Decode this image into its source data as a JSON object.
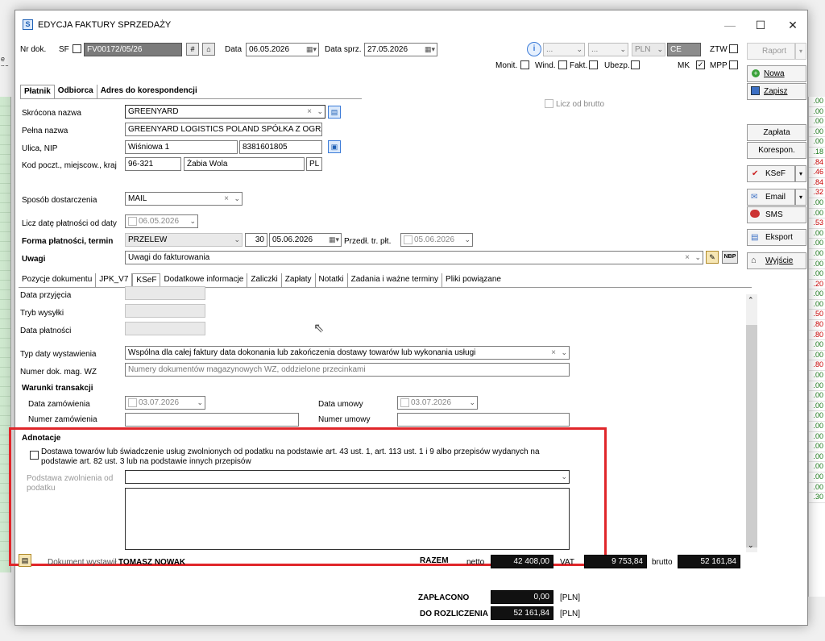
{
  "window": {
    "title": "EDYCJA FAKTURY SPRZEDAŻY"
  },
  "background": {
    "left_text": "e po",
    "right_values": [
      ".00",
      ".00",
      ".00",
      ".00",
      ".00",
      ".18",
      ".84",
      ".46",
      ".84",
      ".32",
      ".00",
      ".00",
      ".53",
      ".00",
      ".00",
      ".00",
      ".00",
      ".00",
      ".20",
      ".00",
      ".00",
      ".50",
      ".80",
      ".80",
      ".00",
      ".00",
      ".80",
      ".00",
      ".00",
      ".00",
      ".00",
      ".00",
      ".00",
      ".00",
      ".00",
      ".00",
      ".00",
      ".00",
      ".00",
      ".30"
    ]
  },
  "header": {
    "nr_dok_label": "Nr dok.",
    "sf_label": "SF",
    "nr_dok_value": "FV00172/05/26",
    "data_label": "Data",
    "data_value": "06.05.2026",
    "data_sprz_label": "Data sprz.",
    "data_sprz_value": "27.05.2026",
    "combo1": "...",
    "combo2": "...",
    "currency": "PLN",
    "ce_value": "CE",
    "ztw_label": "ZTW",
    "monit_label": "Monit.",
    "wind_label": "Wind.",
    "fakt_label": "Fakt.",
    "ubezp_label": "Ubezp.",
    "mk_label": "MK",
    "mpp_label": "MPP"
  },
  "party_tabs": [
    "Płatnik",
    "Odbiorca",
    "Adres do korespondencji"
  ],
  "liczbrutto_label": "Licz od brutto",
  "fields": {
    "skrocona_label": "Skrócona nazwa",
    "skrocona_value": "GREENYARD",
    "pelna_label": "Pełna nazwa",
    "pelna_value": "GREENYARD LOGISTICS POLAND SPÓŁKA Z OGRANICZO",
    "ulica_label": "Ulica, NIP",
    "ulica_value": "Wiśniowa 1",
    "nip_value": "8381601805",
    "kod_label": "Kod poczt., miejscow., kraj",
    "kod_value": "96-321",
    "miejsc_value": "Żabia Wola",
    "kraj_value": "PL",
    "sposob_label": "Sposób dostarczenia",
    "sposob_value": "MAIL",
    "licz_date_label": "Licz datę płatności od daty",
    "licz_date_value": "06.05.2026",
    "forma_label": "Forma płatności, termin",
    "forma_value": "PRZELEW",
    "termin_days": "30",
    "termin_date": "05.06.2026",
    "przedl_label": "Przedł. tr. płt.",
    "przedl_value": "05.06.2026",
    "uwagi_label": "Uwagi",
    "uwagi_value": "Uwagi do fakturowania",
    "nbp_label": "NBP"
  },
  "doc_tabs": [
    "Pozycje dokumentu",
    "JPK_V7",
    "KSeF",
    "Dodatkowe informacje",
    "Zaliczki",
    "Zapłaty",
    "Notatki",
    "Zadania i ważne terminy",
    "Pliki powiązane"
  ],
  "ksef": {
    "data_przyjecia_label": "Data przyjęcia",
    "tryb_wysylki_label": "Tryb wysyłki",
    "data_platnosci_label": "Data płatności",
    "typ_daty_label": "Typ daty wystawienia",
    "typ_daty_value": "Wspólna dla całej faktury data dokonania lub zakończenia dostawy towarów lub wykonania usługi",
    "numer_wz_label": "Numer dok. mag. WZ",
    "numer_wz_placeholder": "Numery dokumentów magazynowych WZ, oddzielone przecinkami",
    "warunki_label": "Warunki transakcji",
    "data_zam_label": "Data zamówienia",
    "data_zam_value": "03.07.2026",
    "numer_zam_label": "Numer zamówienia",
    "data_umowy_label": "Data umowy",
    "data_umowy_value": "03.07.2026",
    "numer_umowy_label": "Numer umowy",
    "adnotacje_label": "Adnotacje",
    "dostawa_line1": "Dostawa towarów lub świadczenie usług zwolnionych od podatku na podstawie art. 43 ust. 1, art. 113 ust. 1 i 9 albo przepisów wydanych na",
    "dostawa_line2": "podstawie art. 82 ust. 3 lub na podstawie innych przepisów",
    "podstawa_line1": "Podstawa zwolnienia od",
    "podstawa_line2": "podatku"
  },
  "footer": {
    "dokument_wystawil_label": "Dokument wystawił :",
    "wystawil_value": "TOMASZ NOWAK",
    "razem_label": "RAZEM",
    "netto_label": "netto",
    "netto_value": "42 408,00",
    "vat_label": "VAT",
    "vat_value": "9 753,84",
    "brutto_label": "brutto",
    "brutto_value": "52 161,84",
    "zaplacono_label": "ZAPŁACONO",
    "zaplacono_value": "0,00",
    "do_rozliczenia_label": "DO ROZLICZENIA",
    "do_rozliczenia_value": "52 161,84",
    "pln1": "[PLN]",
    "pln2": "[PLN]"
  },
  "side_buttons": {
    "raport": "Raport",
    "nowa": "Nowa",
    "zapisz": "Zapisz",
    "zaplata": "Zapłata",
    "korespon": "Korespon.",
    "ksef": "KSeF",
    "email": "Email",
    "sms": "SMS",
    "eksport": "Eksport",
    "wyjscie": "Wyjście"
  },
  "colors": {
    "highlight_frame": "#e0262a",
    "dark_fill": "#111111"
  }
}
